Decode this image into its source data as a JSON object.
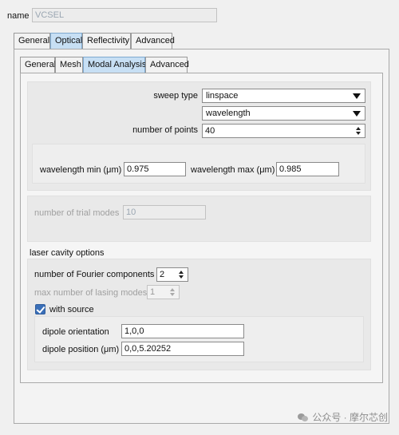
{
  "name_field": {
    "label": "name",
    "value": "VCSEL"
  },
  "main_tabs": [
    {
      "label": "General",
      "active": false
    },
    {
      "label": "Optical",
      "active": true
    },
    {
      "label": "Reflectivity",
      "active": false
    },
    {
      "label": "Advanced",
      "active": false
    }
  ],
  "sub_tabs": [
    {
      "label": "General",
      "active": false
    },
    {
      "label": "Mesh",
      "active": false
    },
    {
      "label": "Modal Analysis",
      "active": true
    },
    {
      "label": "Advanced",
      "active": false
    }
  ],
  "sweep": {
    "sweep_type_label": "sweep type",
    "sweep_type_value": "linspace",
    "sweep_variable_value": "wavelength",
    "num_points_label": "number of points",
    "num_points_value": "40",
    "wl_min_label": "wavelength min (μm)",
    "wl_min_value": "0.975",
    "wl_max_label": "wavelength max (μm)",
    "wl_max_value": "0.985"
  },
  "trial_modes": {
    "label": "number of trial modes",
    "value": "10"
  },
  "laser": {
    "section_label": "laser cavity options",
    "fourier_label": "number of Fourier components",
    "fourier_value": "2",
    "lasing_label": "max number of lasing modes",
    "lasing_value": "1",
    "with_source_label": "with source",
    "with_source_checked": true,
    "dipole_orientation_label": "dipole orientation",
    "dipole_orientation_value": "1,0,0",
    "dipole_position_label": "dipole position (μm)",
    "dipole_position_value": "0,0,5.20252"
  },
  "watermark": {
    "text": "公众号 · 摩尔芯创"
  },
  "colors": {
    "active_tab": "#c7dff4",
    "checkbox": "#3a6fb8",
    "disabled_text": "#a0a0a0"
  }
}
